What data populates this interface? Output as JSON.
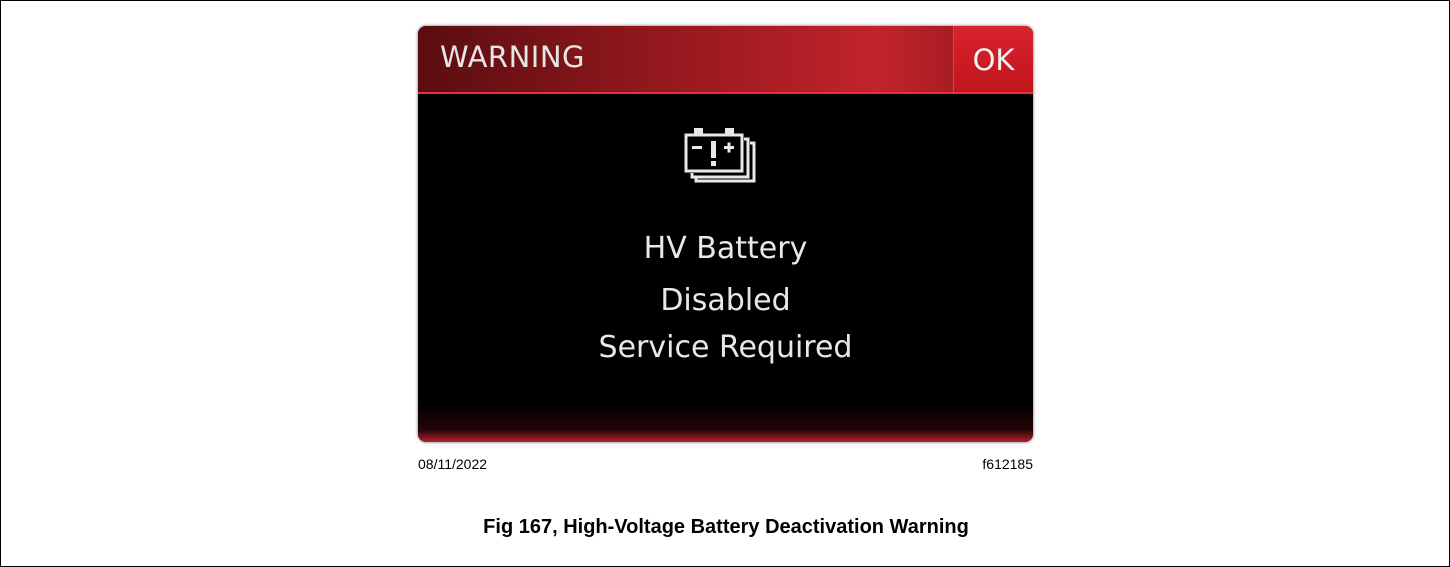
{
  "screen": {
    "title": "WARNING",
    "ok_label": "OK",
    "icon": "battery-warning-icon",
    "message": {
      "line1": "HV Battery",
      "line2": "Disabled",
      "line3": "Service Required"
    },
    "colors": {
      "header_red": "#c2232b",
      "ok_red": "#d8232c",
      "background": "#000000",
      "text": "#e8e8e8"
    }
  },
  "caption": {
    "date": "08/11/2022",
    "figure_id": "f612185",
    "title": "Fig 167, High-Voltage Battery Deactivation Warning"
  }
}
